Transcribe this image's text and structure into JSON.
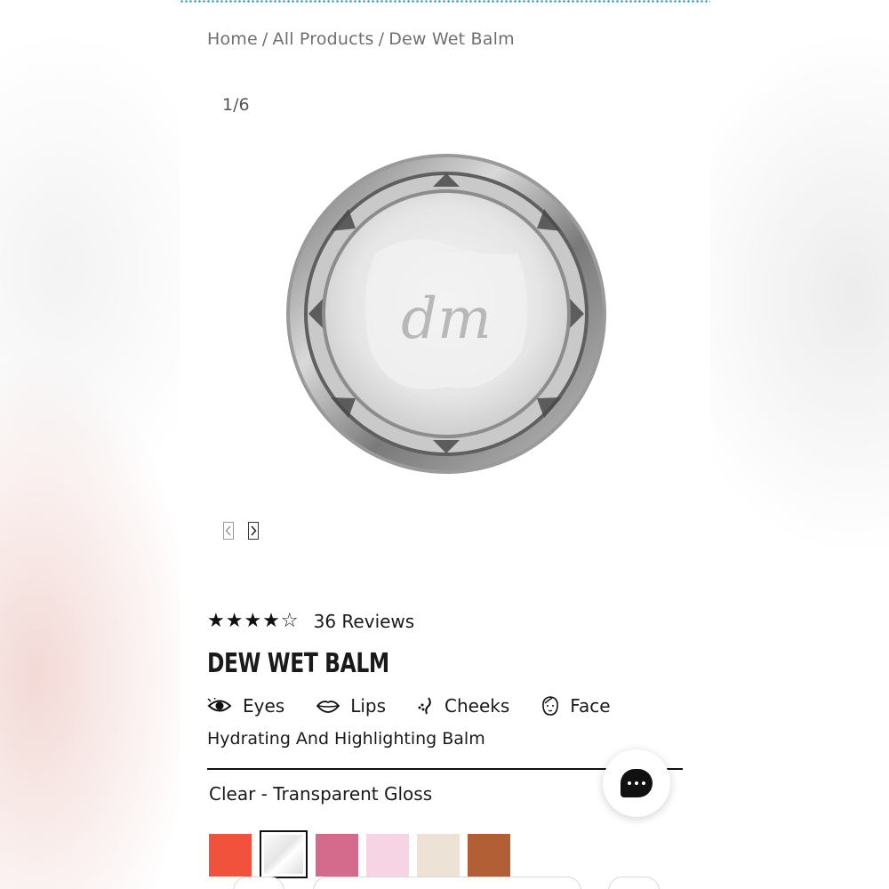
{
  "breadcrumb": {
    "home": "Home",
    "separator": "/",
    "all_products": "All Products",
    "current": "Dew Wet Balm"
  },
  "gallery": {
    "counter": "1/6",
    "prev_icon": "chevron-left-icon",
    "next_icon": "chevron-right-icon",
    "image_logo": "dm"
  },
  "product": {
    "rating": 4,
    "rating_max": 5,
    "stars": "★★★★☆",
    "reviews_label": "36 Reviews",
    "title": "DEW WET BALM",
    "usage": [
      {
        "label": "Eyes",
        "icon": "eye-icon"
      },
      {
        "label": "Lips",
        "icon": "lips-icon"
      },
      {
        "label": "Cheeks",
        "icon": "cheeks-icon"
      },
      {
        "label": "Face",
        "icon": "face-icon"
      }
    ],
    "subtitle": "Hydrating And Highlighting Balm",
    "selected_shade": "Clear - Transparent Gloss"
  },
  "swatches": [
    {
      "color": "#f0523c",
      "selected": false
    },
    {
      "color": "#eeeeee",
      "selected": true
    },
    {
      "color": "#d46a8c",
      "selected": false
    },
    {
      "color": "#f6d4e4",
      "selected": false
    },
    {
      "color": "#ece3d6",
      "selected": false
    },
    {
      "color": "#b35f35",
      "selected": false
    }
  ],
  "chat": {
    "icon": "chat-bubble-icon"
  },
  "colors": {
    "accent": "#35a6a8",
    "text": "#1a1a1a",
    "muted": "#6f6f6f"
  }
}
